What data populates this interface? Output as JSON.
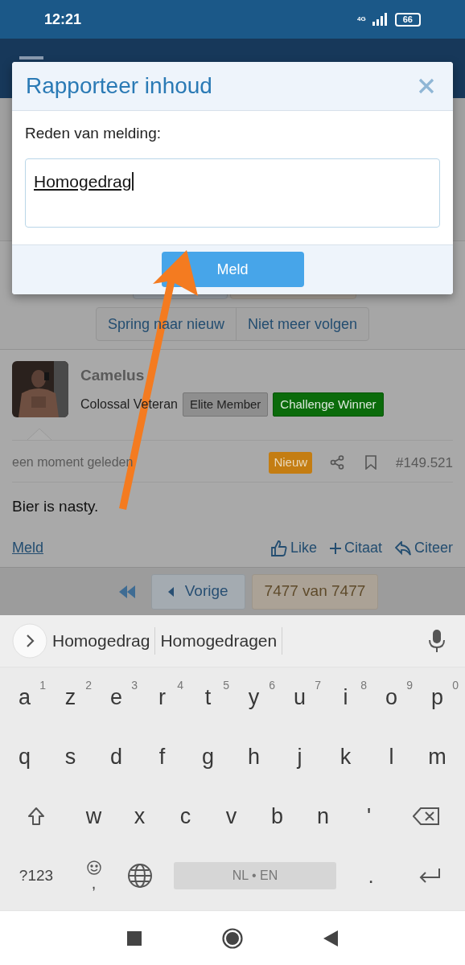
{
  "status_bar": {
    "time": "12:21",
    "network": "4G",
    "battery": "66"
  },
  "dialog": {
    "title": "Rapporteer inhoud",
    "label": "Reden van melding:",
    "value": "Homogedrag",
    "submit": "Meld"
  },
  "thread_buttons": [
    "Spring naar nieuw",
    "Niet meer volgen"
  ],
  "post": {
    "author": "Camelus",
    "user_title": "Colossal Veteran",
    "badges": [
      {
        "label": "Elite Member",
        "color": "#8e8e8e"
      },
      {
        "label": "Challenge Winner",
        "color": "#0b6b0b"
      }
    ],
    "time": "een moment geleden",
    "new_badge": "Nieuw",
    "number": "#149.521",
    "body": "Bier is nasty.",
    "report": "Meld",
    "actions": [
      {
        "kind": "like",
        "label": "Like"
      },
      {
        "kind": "quote",
        "label": "Citaat"
      },
      {
        "kind": "reply",
        "label": "Citeer"
      }
    ]
  },
  "pagination": {
    "previous": "Vorige",
    "page": "7477 van 7477"
  },
  "keyboard": {
    "suggestions": [
      "Homogedrag",
      "Homogedragen"
    ],
    "rows": [
      [
        {
          "key": "a",
          "hint": "1"
        },
        {
          "key": "z",
          "hint": "2"
        },
        {
          "key": "e",
          "hint": "3"
        },
        {
          "key": "r",
          "hint": "4"
        },
        {
          "key": "t",
          "hint": "5"
        },
        {
          "key": "y",
          "hint": "6"
        },
        {
          "key": "u",
          "hint": "7"
        },
        {
          "key": "i",
          "hint": "8"
        },
        {
          "key": "o",
          "hint": "9"
        },
        {
          "key": "p",
          "hint": "0"
        }
      ],
      [
        {
          "key": "q"
        },
        {
          "key": "s"
        },
        {
          "key": "d"
        },
        {
          "key": "f"
        },
        {
          "key": "g"
        },
        {
          "key": "h"
        },
        {
          "key": "j"
        },
        {
          "key": "k"
        },
        {
          "key": "l"
        },
        {
          "key": "m"
        }
      ],
      [
        {
          "key": "w"
        },
        {
          "key": "x"
        },
        {
          "key": "c"
        },
        {
          "key": "v"
        },
        {
          "key": "b"
        },
        {
          "key": "n"
        },
        {
          "key": "'"
        }
      ]
    ],
    "symbols": "?123",
    "comma": ",",
    "space": "NL • EN",
    "period": "."
  }
}
